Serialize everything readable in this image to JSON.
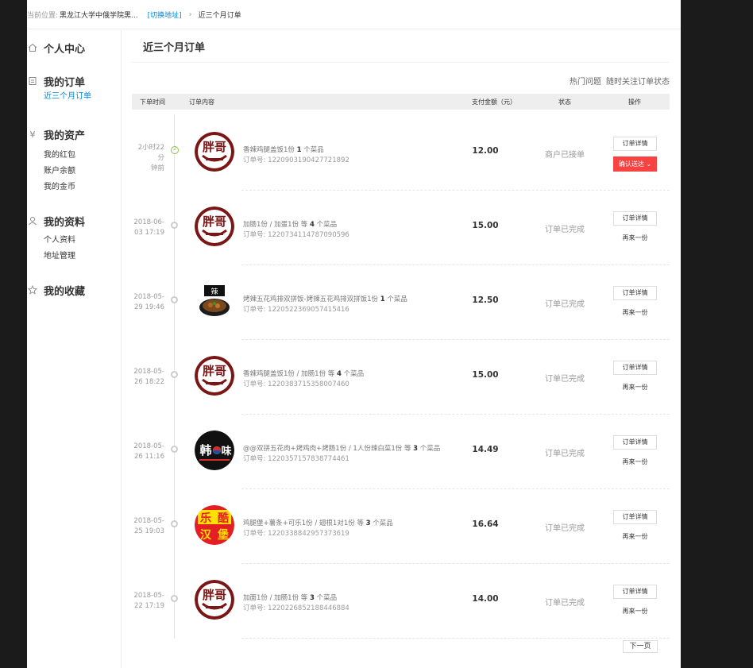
{
  "breadcrumb": {
    "label": "当前位置:",
    "address": "黑龙江大学中俄学院黑...",
    "switch": "[切换地址]",
    "separator": "›",
    "current": "近三个月订单"
  },
  "sidebar": {
    "sections": [
      {
        "title": "个人中心",
        "icon": "home-icon",
        "items": []
      },
      {
        "title": "我的订单",
        "icon": "document-icon",
        "items": [
          {
            "label": "近三个月订单",
            "active": true
          }
        ]
      },
      {
        "title": "我的资产",
        "icon": "yen-icon",
        "items": [
          {
            "label": "我的红包"
          },
          {
            "label": "账户余额"
          },
          {
            "label": "我的金币"
          }
        ]
      },
      {
        "title": "我的资料",
        "icon": "user-icon",
        "items": [
          {
            "label": "个人资料"
          },
          {
            "label": "地址管理"
          }
        ]
      },
      {
        "title": "我的收藏",
        "icon": "star-icon",
        "items": []
      }
    ]
  },
  "main": {
    "title": "近三个月订单",
    "links": [
      "热门问题",
      "随时关注订单状态"
    ],
    "columns": {
      "time": "下单时间",
      "content": "订单内容",
      "amount": "支付金额（元）",
      "status": "状态",
      "action": "操作"
    },
    "orders": [
      {
        "time1": "2小时22分",
        "time2": "钟前",
        "logo": "pangge",
        "items_text": "香辣鸡腿盖饭1份",
        "count": "1",
        "count_suffix": "个菜品",
        "order_label": "订单号: ",
        "order_no": "1220903190427721892",
        "amount": "12.00",
        "status": "商户已接单",
        "detail": "订单详情",
        "action": "确认送达",
        "action_type": "confirm"
      },
      {
        "time1": "2018-06-",
        "time2": "03 17:19",
        "logo": "pangge",
        "items_text": "加肠1份 / 加蛋1份 等",
        "count": "4",
        "count_suffix": "个菜品",
        "order_label": "订单号: ",
        "order_no": "1220734114787090596",
        "amount": "15.00",
        "status": "订单已完成",
        "detail": "订单详情",
        "action": "再来一份",
        "action_type": "again"
      },
      {
        "time1": "2018-05-",
        "time2": "29 19:46",
        "logo": "bowl",
        "items_text": "烤辣五花鸡排双拼饭-烤辣五花鸡排双拼饭1份",
        "count": "1",
        "count_suffix": "个菜品",
        "order_label": "订单号: ",
        "order_no": "1220522369057415416",
        "amount": "12.50",
        "status": "订单已完成",
        "detail": "订单详情",
        "action": "再来一份",
        "action_type": "again"
      },
      {
        "time1": "2018-05-",
        "time2": "26 18:22",
        "logo": "pangge",
        "items_text": "香辣鸡腿盖饭1份 / 加肠1份 等",
        "count": "4",
        "count_suffix": "个菜品",
        "order_label": "订单号: ",
        "order_no": "1220383715358007460",
        "amount": "15.00",
        "status": "订单已完成",
        "detail": "订单详情",
        "action": "再来一份",
        "action_type": "again"
      },
      {
        "time1": "2018-05-",
        "time2": "26 11:16",
        "logo": "hanwei",
        "items_text": "@@双拼五花肉+烤鸡肉+烤肠1份 / 1人份辣白菜1份 等",
        "count": "3",
        "count_suffix": "个菜品",
        "order_label": "订单号: ",
        "order_no": "1220357157838774461",
        "amount": "14.49",
        "status": "订单已完成",
        "detail": "订单详情",
        "action": "再来一份",
        "action_type": "again"
      },
      {
        "time1": "2018-05-",
        "time2": "25 19:03",
        "logo": "leku",
        "items_text": "鸡腿堡+薯条+可乐1份 / 翅根1对1份 等",
        "count": "3",
        "count_suffix": "个菜品",
        "order_label": "订单号: ",
        "order_no": "1220338842957373619",
        "amount": "16.64",
        "status": "订单已完成",
        "detail": "订单详情",
        "action": "再来一份",
        "action_type": "again"
      },
      {
        "time1": "2018-05-",
        "time2": "22 17:19",
        "logo": "pangge",
        "items_text": "加面1份 / 加肠1份 等",
        "count": "3",
        "count_suffix": "个菜品",
        "order_label": "订单号: ",
        "order_no": "1220226852188446884",
        "amount": "14.00",
        "status": "订单已完成",
        "detail": "订单详情",
        "action": "再来一份",
        "action_type": "again"
      }
    ],
    "next_page": "下一页"
  },
  "colors": {
    "accent": "#0089dc",
    "confirm": "#f74342",
    "pangge_red": "#8b1a1a",
    "timeline_active": "#8bc34a"
  }
}
